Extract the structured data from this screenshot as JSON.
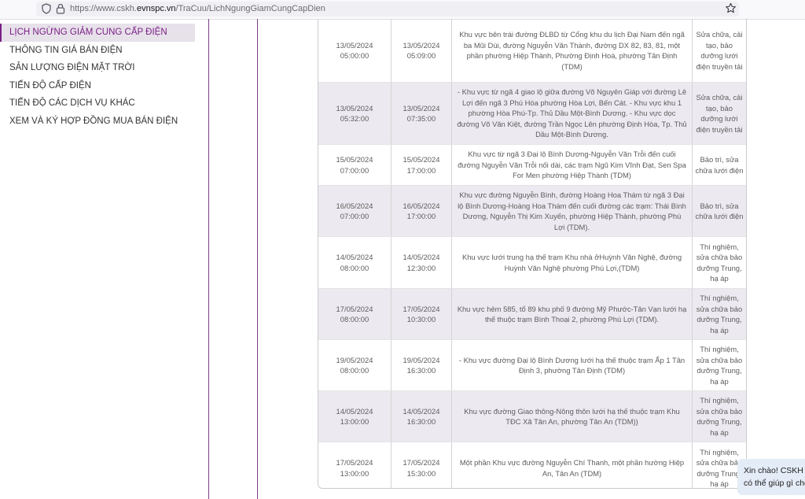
{
  "browser": {
    "url_prefix": "https://www.cskh.",
    "url_domain": "evnspc.vn",
    "url_path": "/TraCuu/LichNgungGiamCungCapDien"
  },
  "sidebar": {
    "items": [
      {
        "label": "LỊCH NGỪNG GIẢM CUNG CẤP ĐIỆN",
        "active": true
      },
      {
        "label": "THÔNG TIN GIÁ BÁN ĐIỆN"
      },
      {
        "label": "SẢN LƯỢNG ĐIỆN MẶT TRỜI"
      },
      {
        "label": "TIẾN ĐỘ CẤP ĐIỆN"
      },
      {
        "label": "TIẾN ĐỘ CÁC DỊCH VỤ KHÁC"
      },
      {
        "label": "XEM VÀ KÝ HỢP ĐỒNG MUA BÁN ĐIỆN"
      }
    ]
  },
  "table": {
    "rows": [
      {
        "start_date": "13/05/2024",
        "start_time": "05:00:00",
        "end_date": "13/05/2024",
        "end_time": "05:09:00",
        "area": "Khu vực bên trái đường ĐLBD từ Cổng khu du lịch Đại Nam đến ngã ba Mũi Dùi, đường Nguyễn Văn Thành, đường DX 82, 83, 81, một phần phường Hiệp Thành, Phường Định Hoà, phường Tân Định (TDM)",
        "reason": "Sửa chữa, cải tạo, bảo dưỡng lưới điện truyền tải"
      },
      {
        "start_date": "13/05/2024",
        "start_time": "05:32:00",
        "end_date": "13/05/2024",
        "end_time": "07:35:00",
        "area": "- Khu vực từ ngã 4 giao lộ giữa đường Võ Nguyên Giáp với đường Lê Lợi đến ngã 3 Phú Hòa phường Hòa Lợi, Bến Cát. - Khu vực khu 1 phường Hòa Phú-Tp. Thủ Dầu Một-Bình Dương. - Khu vực dọc đường Võ Văn Kiệt, đường Trần Ngọc Lên phường Định Hòa, Tp. Thủ Dầu Một-Bình Dương.",
        "reason": "Sửa chữa, cải tạo, bảo dưỡng lưới điện truyền tải"
      },
      {
        "start_date": "15/05/2024",
        "start_time": "07:00:00",
        "end_date": "15/05/2024",
        "end_time": "17:00:00",
        "area": "Khu vực từ ngã 3 Đại lộ Bình Dương-Nguyễn Văn Trỗi đến cuối đường Nguyễn Văn Trỗi nối dài, các trạm Ngũ Kim Vĩnh Đạt, Sen Spa For Men phường Hiệp Thành (TDM)",
        "reason": "Bảo trì, sửa chữa lưới điện"
      },
      {
        "start_date": "16/05/2024",
        "start_time": "07:00:00",
        "end_date": "16/05/2024",
        "end_time": "17:00:00",
        "area": "Khu vực đường Nguyễn Bình, đường Hoàng Hoa Thám từ ngã 3 Đại lộ Bình Dương-Hoàng Hoa Thám đến cuối đường các trạm: Thái Bình Dương, Nguyễn Thị Kim Xuyến, phường Hiệp Thành, phường Phú Lợi (TDM).",
        "reason": "Bảo trì, sửa chữa lưới điện"
      },
      {
        "start_date": "14/05/2024",
        "start_time": "08:00:00",
        "end_date": "14/05/2024",
        "end_time": "12:30:00",
        "area": "Khu vực lưới trung hạ thế trạm Khu nhà ởHuỳnh Văn Nghệ, đường Huỳnh Văn Nghệ phường Phú Lợi,(TDM)",
        "reason": "Thí nghiệm, sửa chữa bảo dưỡng Trung, hạ áp"
      },
      {
        "start_date": "17/05/2024",
        "start_time": "08:00:00",
        "end_date": "17/05/2024",
        "end_time": "10:30:00",
        "area": "Khu vực hẻm 585, tổ 89 khu phố 9 đường Mỹ Phước-Tân Vạn lưới hạ thế thuộc trạm Bình Thoại 2, phường Phú Lợi (TDM).",
        "reason": "Thí nghiệm, sửa chữa bảo dưỡng Trung, hạ áp"
      },
      {
        "start_date": "19/05/2024",
        "start_time": "08:00:00",
        "end_date": "19/05/2024",
        "end_time": "16:30:00",
        "area": "- Khu vực đường Đại lộ Bình Dương lưới hạ thế thuộc trạm Ấp 1 Tân Định 3, phường Tân Định (TDM)",
        "reason": "Thí nghiệm, sửa chữa bảo dưỡng Trung, hạ áp"
      },
      {
        "start_date": "14/05/2024",
        "start_time": "13:00:00",
        "end_date": "14/05/2024",
        "end_time": "16:30:00",
        "area": "Khu vực đường Giao thông-Nông thôn lưới hạ thế thuộc trạm Khu TĐC Xã Tân An, phường Tân An (TDM))",
        "reason": "Thí nghiệm, sửa chữa bảo dưỡng Trung, hạ áp"
      },
      {
        "start_date": "17/05/2024",
        "start_time": "13:00:00",
        "end_date": "17/05/2024",
        "end_time": "15:30:00",
        "area": "Một phần Khu vực đường Nguyễn Chí Thanh, một phần hường Hiệp An, Tân An (TDM)",
        "reason": "Thí nghiệm, sửa chữa bảo dưỡng Trung, hạ áp"
      }
    ]
  },
  "chat": {
    "line1": "Xin chào! CSKH",
    "line2": "có thể giúp gì cho"
  },
  "colors": {
    "accent": "#7a1f86",
    "active_bg": "#e7e1ea",
    "alt_row_bg": "#ede9f0",
    "chat_bg": "#e4ecf7"
  }
}
